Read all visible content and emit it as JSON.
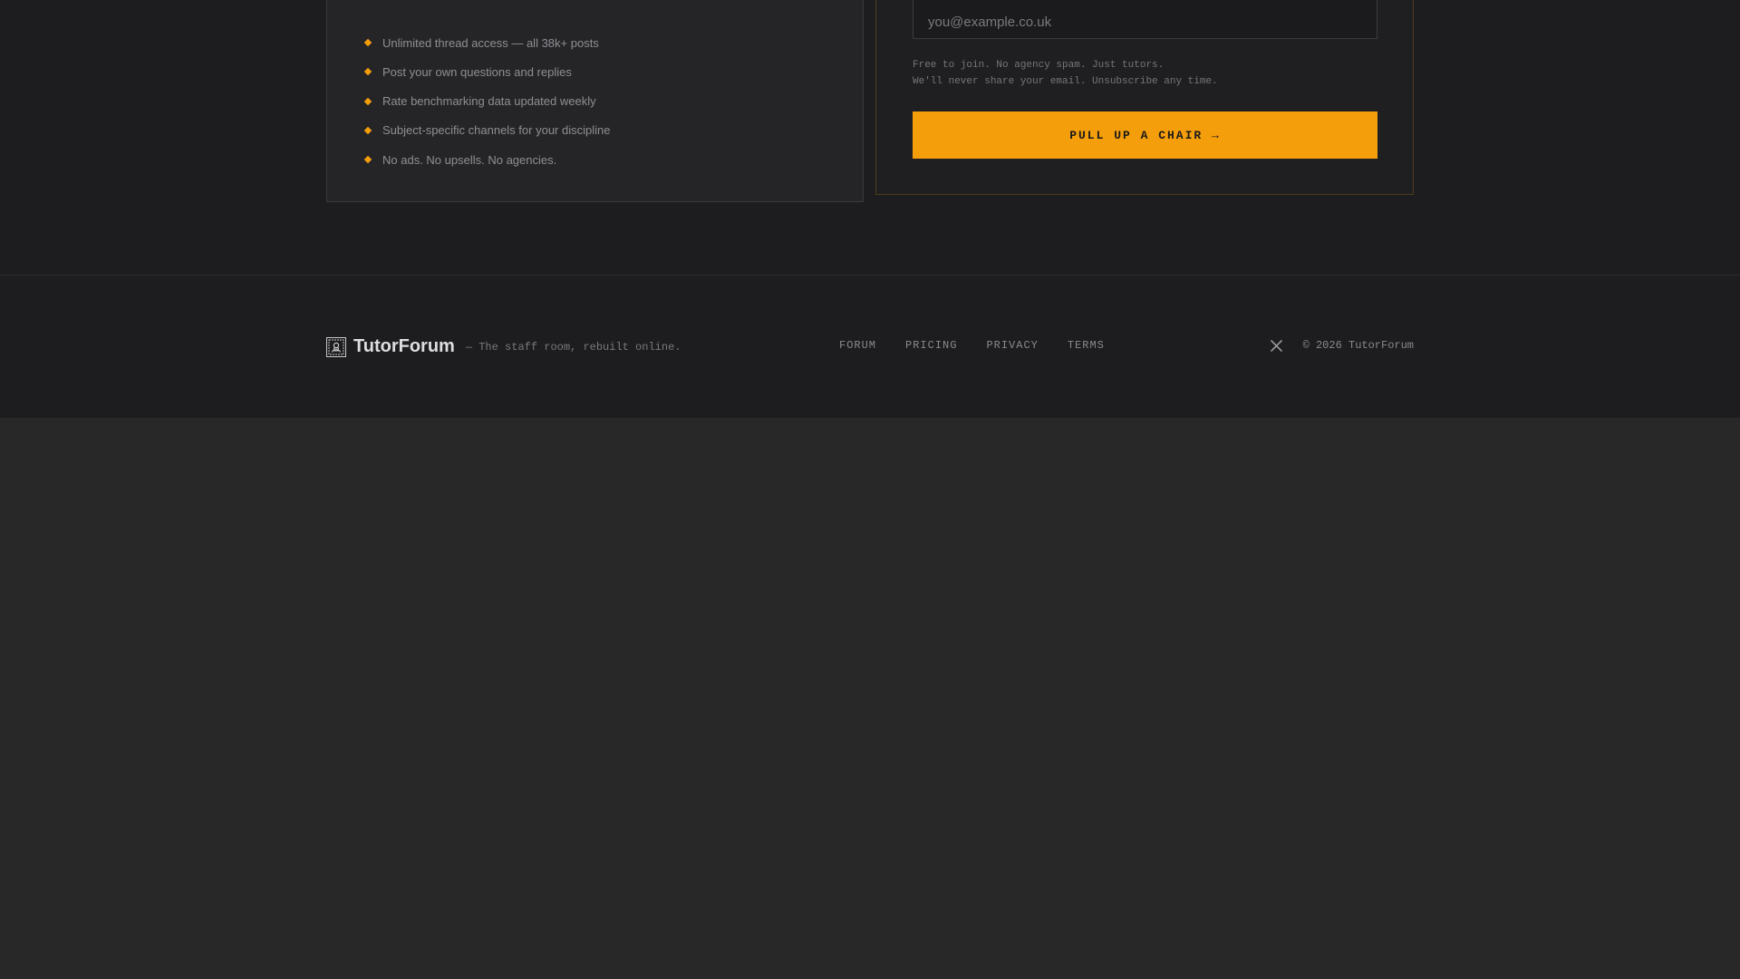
{
  "features": {
    "items": [
      "Unlimited thread access — all 38k+ posts",
      "Post your own questions and replies",
      "Rate benchmarking data updated weekly",
      "Subject-specific channels for your discipline",
      "No ads. No upsells. No agencies."
    ],
    "bullet_icon": "diamond-bullet-icon"
  },
  "signup": {
    "email_placeholder": "you@example.co.uk",
    "fine_print_line1": "Free to join. No agency spam. Just tutors.",
    "fine_print_line2": "We'll never share your email. Unsubscribe any time.",
    "cta_label": "PULL UP A CHAIR →"
  },
  "footer": {
    "brand_name": "TutorForum",
    "tagline": "— The staff room, rebuilt online.",
    "logo_icon": "tutorforum-logo-icon",
    "nav": {
      "forum": "FORUM",
      "pricing": "PRICING",
      "privacy": "PRIVACY",
      "terms": "TERMS"
    },
    "social_icon": "x-icon",
    "copyright": "© 2026 TutorForum"
  },
  "colors": {
    "accent": "#f59e0b",
    "background": "#1d1d1f",
    "page_below": "#282828"
  }
}
